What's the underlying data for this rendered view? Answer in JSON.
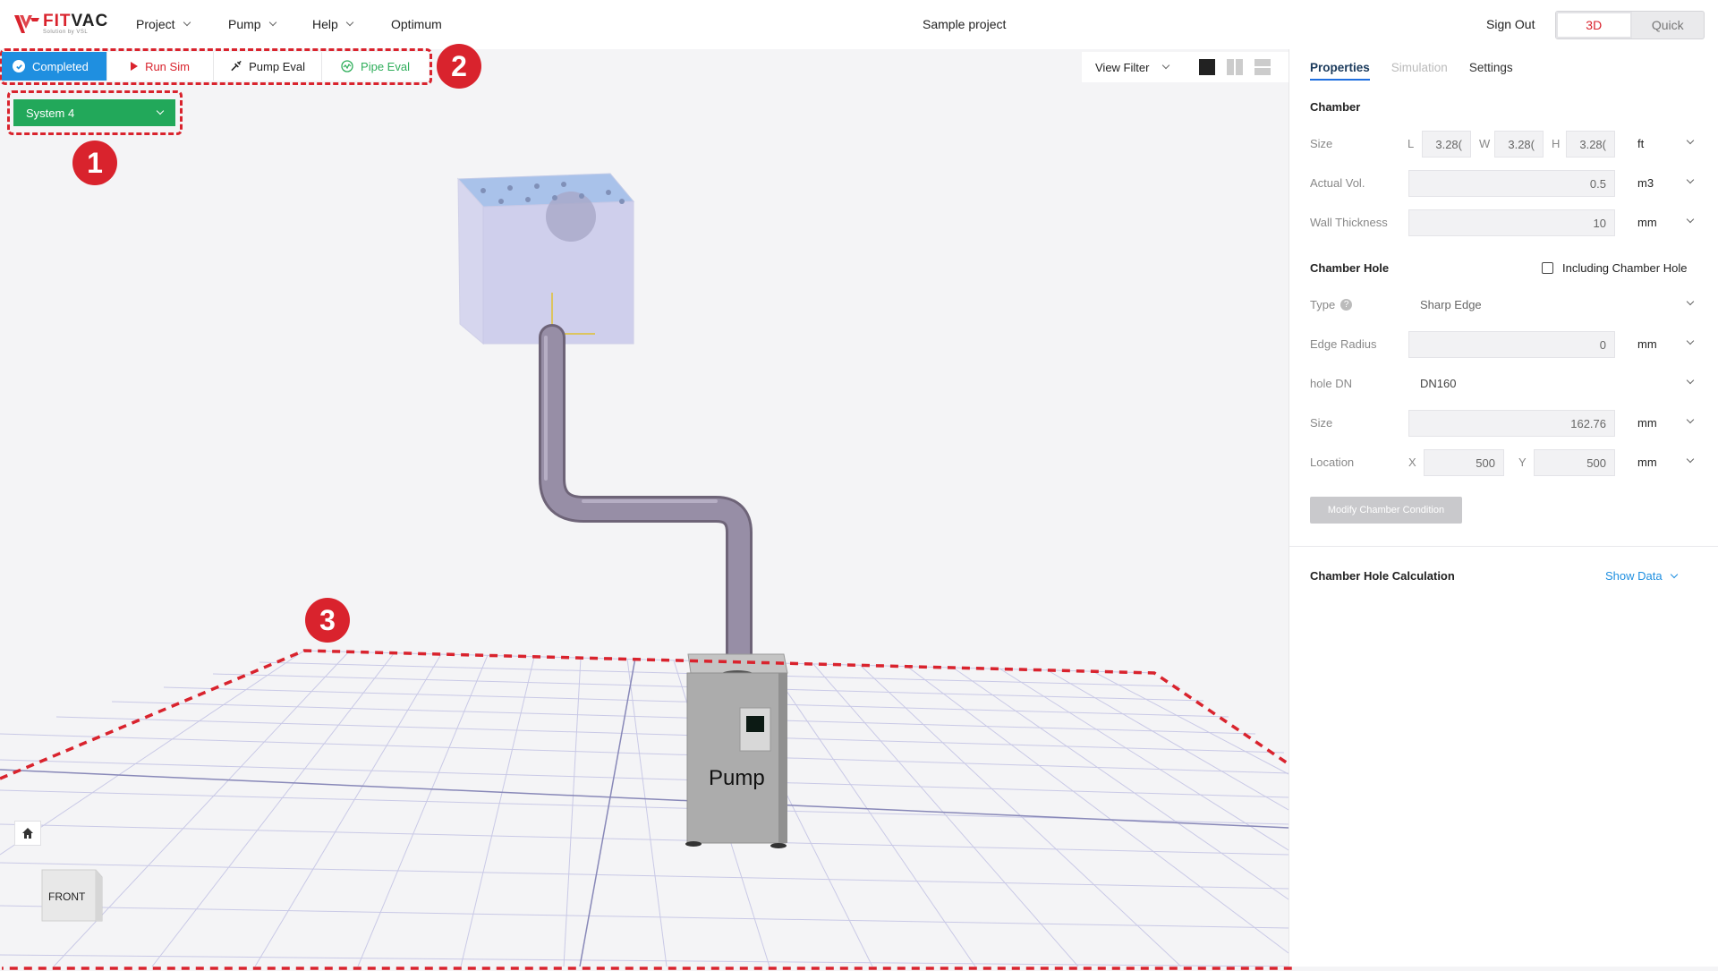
{
  "header": {
    "logo_brand_fit": "FIT",
    "logo_brand_vac": "VAC",
    "logo_tagline": "Solution by VSL",
    "menu": [
      {
        "label": "Project"
      },
      {
        "label": "Pump"
      },
      {
        "label": "Help"
      },
      {
        "label": "Optimum"
      }
    ],
    "project_title": "Sample project",
    "sign_out": "Sign Out",
    "mode_3d": "3D",
    "mode_quick": "Quick"
  },
  "toolbar": {
    "completed": "Completed",
    "run_sim": "Run Sim",
    "pump_eval": "Pump Eval",
    "pipe_eval": "Pipe Eval"
  },
  "system_select": "System 4",
  "annotations": [
    "1",
    "2",
    "3"
  ],
  "view_filter": "View Filter",
  "scene": {
    "pump_label": "Pump",
    "front_label": "FRONT"
  },
  "panel": {
    "tabs": [
      "Properties",
      "Simulation",
      "Settings"
    ],
    "chamber_title": "Chamber",
    "size_label": "Size",
    "size_l_label": "L",
    "size_w_label": "W",
    "size_h_label": "H",
    "size_l": "3.28(",
    "size_w": "3.28(",
    "size_h": "3.28(",
    "size_unit": "ft",
    "actual_vol_label": "Actual Vol.",
    "actual_vol": "0.5",
    "actual_vol_unit": "m3",
    "wall_thickness_label": "Wall Thickness",
    "wall_thickness": "10",
    "wall_thickness_unit": "mm",
    "chamber_hole_title": "Chamber Hole",
    "including_hole": "Including Chamber Hole",
    "type_label": "Type",
    "type_value": "Sharp Edge",
    "edge_radius_label": "Edge Radius",
    "edge_radius": "0",
    "edge_radius_unit": "mm",
    "hole_dn_label": "hole DN",
    "hole_dn": "DN160",
    "hole_size_label": "Size",
    "hole_size": "162.76",
    "hole_size_unit": "mm",
    "location_label": "Location",
    "loc_x_label": "X",
    "loc_x": "500",
    "loc_y_label": "Y",
    "loc_y": "500",
    "location_unit": "mm",
    "modify_button": "Modify Chamber Condition",
    "calc_title": "Chamber Hole Calculation",
    "show_data": "Show Data"
  },
  "colors": {
    "brand_red": "#d9232d",
    "completed_blue": "#1f8fe0",
    "system_green": "#22a85a",
    "pipe_eval_green": "#2fae5b"
  }
}
